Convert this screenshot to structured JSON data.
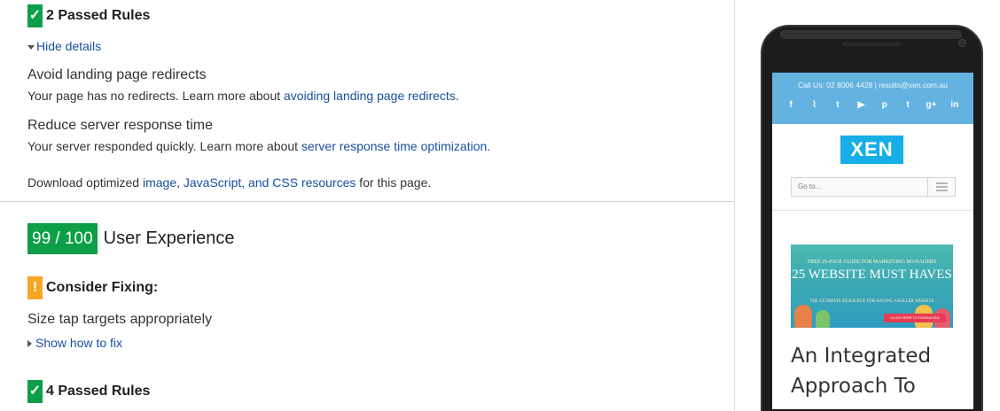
{
  "passed_rules_1": {
    "badge_icon": "check-icon",
    "label": "2 Passed Rules"
  },
  "hide_details": {
    "label": "Hide details"
  },
  "rules_passed": [
    {
      "title": "Avoid landing page redirects",
      "desc_before": "Your page has no redirects. Learn more about ",
      "link": "avoiding landing page redirects",
      "desc_after": "."
    },
    {
      "title": "Reduce server response time",
      "desc_before": "Your server responded quickly. Learn more about ",
      "link": "server response time optimization",
      "desc_after": "."
    }
  ],
  "download": {
    "before": "Download optimized ",
    "link1": "image",
    "sep1": ", ",
    "link2": "JavaScript, and CSS resources",
    "after": " for this page."
  },
  "score": {
    "value": "99 / 100",
    "label": "User Experience"
  },
  "consider_fixing": {
    "badge": "!",
    "label": "Consider Fixing:"
  },
  "fix_rule": {
    "title": "Size tap targets appropriately",
    "toggle": "Show how to fix"
  },
  "passed_rules_2": {
    "label": "4 Passed Rules"
  },
  "phone": {
    "contact": "Call Us: 02 8006 4428  |  results@xen.com.au",
    "socials": [
      "facebook-icon",
      "rss-icon",
      "twitter-icon",
      "youtube-icon",
      "pinterest-icon",
      "tumblr-icon",
      "googleplus-icon",
      "linkedin-icon"
    ],
    "social_glyphs": [
      "f",
      "⌇",
      "t",
      "▶",
      "p",
      "t",
      "g+",
      "in"
    ],
    "logo": "XEN",
    "goto_placeholder": "Go to...",
    "banner_top": "FREE 25-PAGE GUIDE FOR MARKETING MANAGERS",
    "banner_main": "25 WEBSITE MUST HAVES",
    "banner_sub": "THE ULTIMATE RESOURCE FOR HAVING A KILLER WEBSITE",
    "banner_cta": "CLICK HERE TO DOWNLOAD",
    "headline": "An Integrated Approach To",
    "colors": {
      "topbar": "#63b2e0",
      "logo": "#16aee6"
    }
  },
  "colors": {
    "pass": "#0d9e48",
    "warn": "#f5a623",
    "link": "#1a4fa0"
  }
}
